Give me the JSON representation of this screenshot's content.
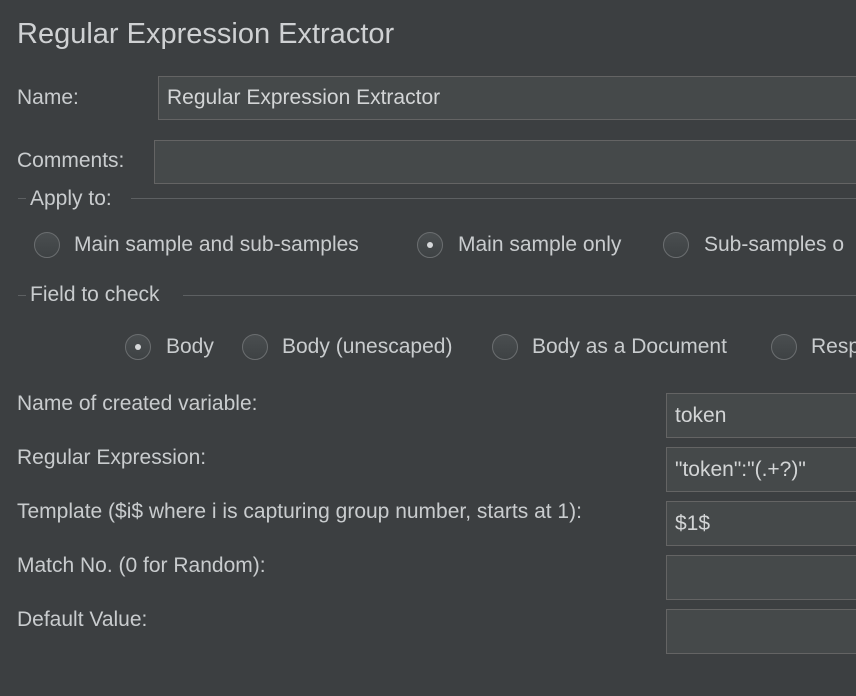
{
  "title": "Regular Expression Extractor",
  "name_label": "Name:",
  "name_value": "Regular Expression Extractor",
  "comments_label": "Comments:",
  "comments_value": "",
  "apply_to": {
    "legend": "Apply to:",
    "options": [
      "Main sample and sub-samples",
      "Main sample only",
      "Sub-samples o"
    ],
    "selected": "Main sample only"
  },
  "field_to_check": {
    "legend": "Field to check",
    "options": [
      "Body",
      "Body (unescaped)",
      "Body as a Document",
      "Resp"
    ],
    "selected": "Body"
  },
  "form": {
    "variable_label": "Name of created variable:",
    "variable_value": "token",
    "regex_label": "Regular Expression:",
    "regex_value": "\"token\":\"(.+?)\"",
    "template_label": "Template ($i$ where i is capturing group number, starts at 1):",
    "template_value": "$1$",
    "match_label": "Match No. (0 for Random):",
    "match_value": "",
    "default_label": "Default Value:",
    "default_value": ""
  }
}
